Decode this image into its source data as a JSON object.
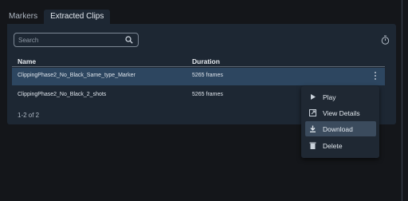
{
  "tabs": [
    {
      "label": "Markers",
      "active": false
    },
    {
      "label": "Extracted Clips",
      "active": true
    }
  ],
  "search": {
    "placeholder": "Search",
    "value": ""
  },
  "table": {
    "columns": [
      "Name",
      "Duration"
    ],
    "rows": [
      {
        "name": "ClippingPhase2_No_Black_Same_type_Marker",
        "duration": "5265 frames",
        "selected": true
      },
      {
        "name": "ClippingPhase2_No_Black_2_shots",
        "duration": "5265 frames",
        "selected": false
      }
    ]
  },
  "pagination": {
    "range": "1-2 of 2"
  },
  "context_menu": {
    "items": [
      {
        "label": "Play",
        "icon": "play-icon"
      },
      {
        "label": "View Details",
        "icon": "external-link-icon"
      },
      {
        "label": "Download",
        "icon": "download-icon",
        "highlighted": true
      },
      {
        "label": "Delete",
        "icon": "trash-icon"
      }
    ]
  },
  "colors": {
    "background": "#14161a",
    "panel": "#1d2733",
    "selected_row": "#2d4660",
    "menu": "#1f2833",
    "menu_highlight": "#3b4b5d"
  }
}
